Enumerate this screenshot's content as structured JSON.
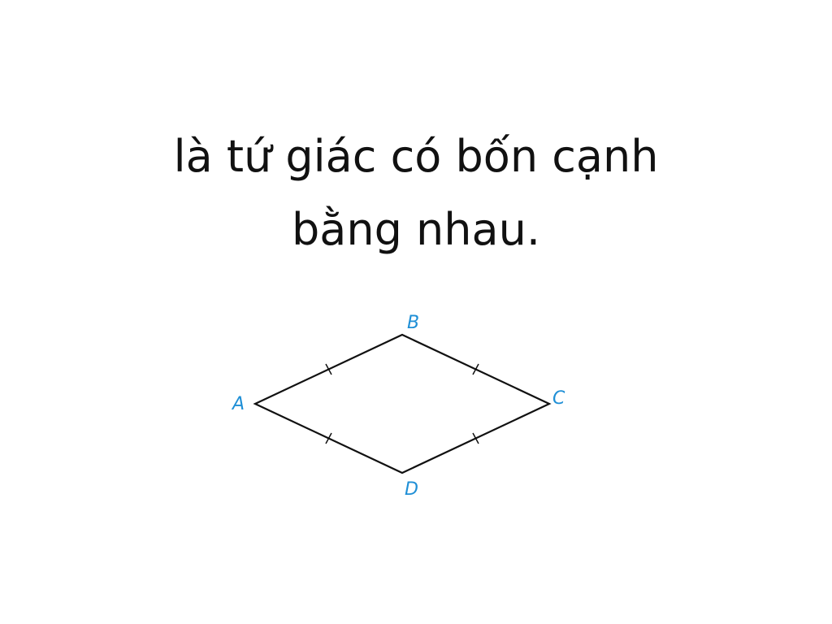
{
  "caption": {
    "line1": "là tứ giác có bốn cạnh",
    "line2": "bằng nhau."
  },
  "figure": {
    "vertices": {
      "A": "A",
      "B": "B",
      "C": "C",
      "D": "D"
    },
    "colors": {
      "edge": "#111111",
      "label": "#1f8fd6"
    }
  }
}
